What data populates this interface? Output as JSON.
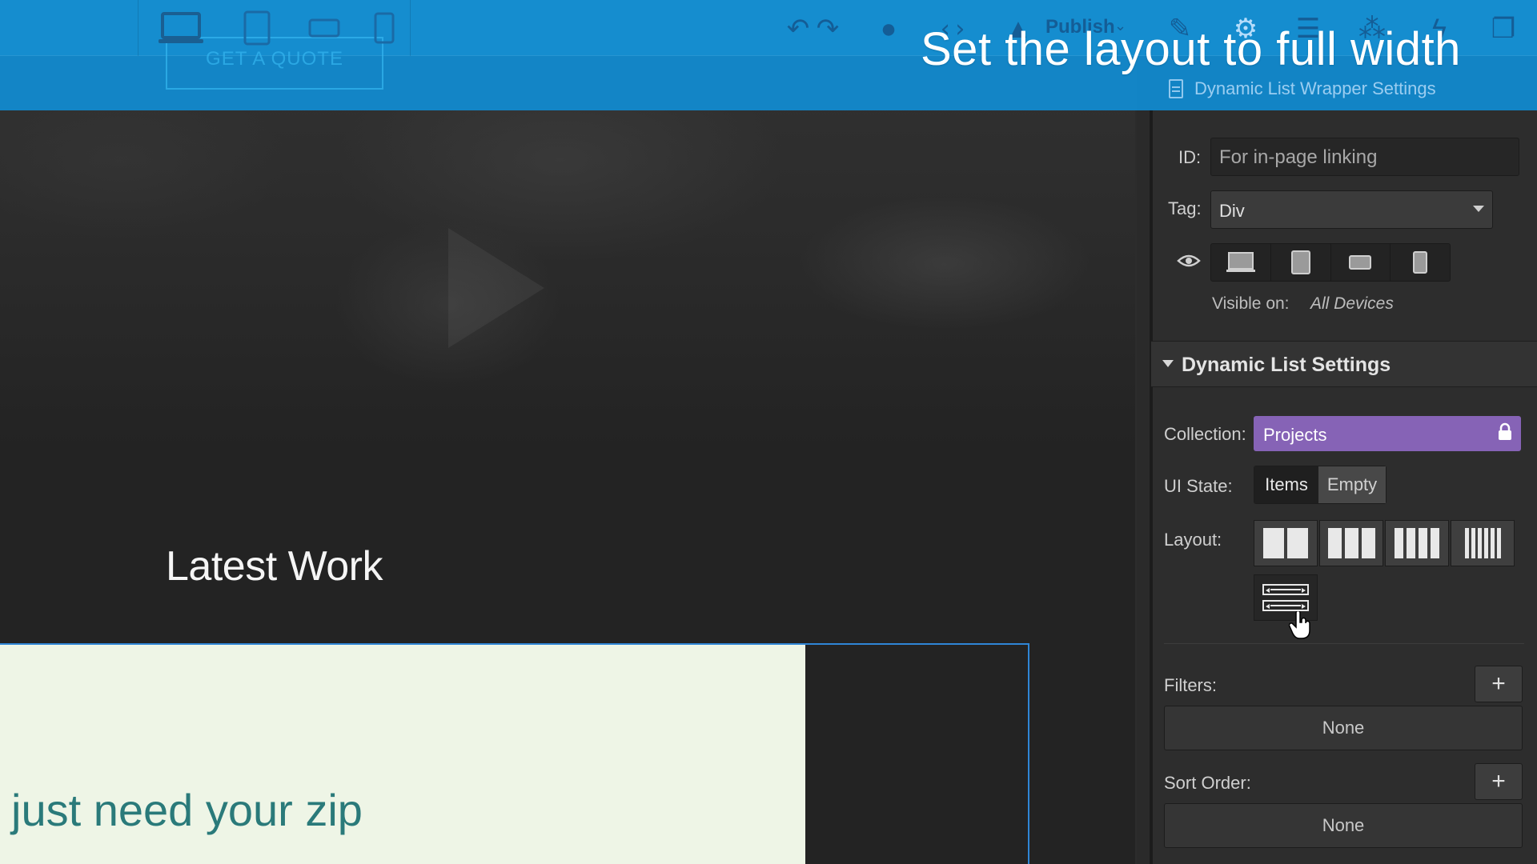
{
  "caption": "Set the layout to full width",
  "canvas": {
    "quote_button": "GET A QUOTE",
    "section_heading": "Latest Work",
    "card_text": "just need your zip"
  },
  "toolbar": {
    "publish_label": "Publish",
    "device_icons": [
      "desktop-icon",
      "tablet-icon",
      "landscape-phone-icon",
      "phone-icon"
    ],
    "action_icons": [
      "undo-icon",
      "redo-icon",
      "comment-icon",
      "code-icon",
      "publish-icon",
      "brush-icon",
      "gear-icon",
      "navigator-icon",
      "drops-icon",
      "interactions-icon",
      "pages-icon"
    ]
  },
  "panel": {
    "breadcrumb": "Dynamic List Wrapper Settings",
    "id_label": "ID:",
    "id_placeholder": "For in-page linking",
    "tag_label": "Tag:",
    "tag_value": "Div",
    "visible_on_label": "Visible on:",
    "visible_on_value": "All Devices",
    "section_title": "Dynamic List Settings",
    "collection_label": "Collection:",
    "collection_value": "Projects",
    "ui_state_label": "UI State:",
    "ui_state_options": [
      "Items",
      "Empty"
    ],
    "ui_state_selected": "Items",
    "layout_label": "Layout:",
    "layout_options": [
      "2 columns",
      "3 columns",
      "4 columns",
      "6 columns",
      "full width"
    ],
    "filters_label": "Filters:",
    "filters_value": "None",
    "sort_label": "Sort Order:",
    "sort_value": "None",
    "add_symbol": "+"
  },
  "colors": {
    "topbar": "#1288cc",
    "collection": "#8663b6",
    "panel_bg": "#2d2d2d",
    "card_bg": "#eef5e6",
    "card_text": "#2a7a7a",
    "selection_outline": "#2f86d6"
  }
}
